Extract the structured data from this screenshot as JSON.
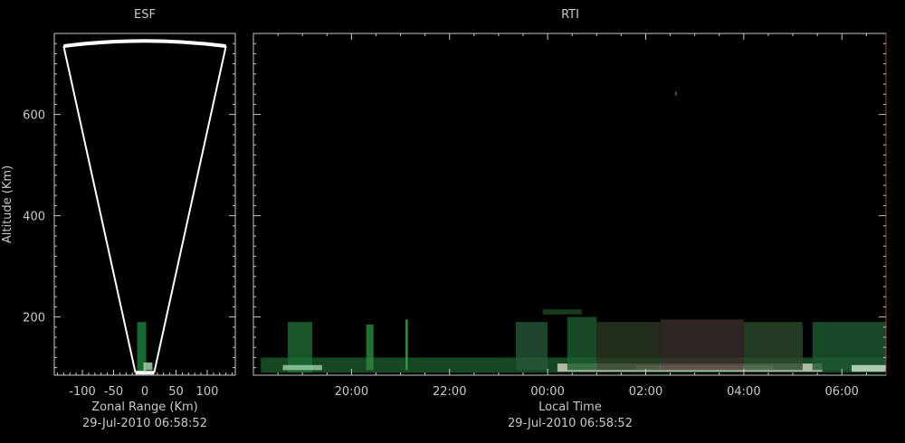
{
  "chart_data": [
    {
      "type": "heatmap",
      "title": "ESF",
      "xlabel": "Zonal Range (Km)",
      "ylabel": "Altitude (Km)",
      "timestamp": "29-Jul-2010 06:58:52",
      "x_ticks": [
        -100,
        -50,
        0,
        50,
        100
      ],
      "x_tick_labels": [
        "-100",
        "-50",
        "0",
        "50",
        "100"
      ],
      "xlim": [
        -145,
        145
      ],
      "y_ticks": [
        200,
        400,
        600
      ],
      "y_tick_labels": [
        "200",
        "400",
        "600"
      ],
      "ylim": [
        85,
        760
      ],
      "fan": {
        "inner_radius_km": 90,
        "outer_radius_km": 745,
        "top_half_width_km": 130,
        "bottom_half_width_km": 15
      },
      "echoes": [
        {
          "x": -5,
          "y0": 90,
          "y1": 190,
          "color": "#1c7a3c"
        },
        {
          "x": 5,
          "y0": 95,
          "y1": 110,
          "color": "#9fd0a8"
        }
      ]
    },
    {
      "type": "heatmap",
      "title": "RTI",
      "xlabel": "Local Time",
      "timestamp": "29-Jul-2010 06:58:52",
      "x_ticks": [
        20,
        22,
        24,
        26,
        28,
        30
      ],
      "x_tick_labels": [
        "20:00",
        "22:00",
        "00:00",
        "02:00",
        "04:00",
        "06:00"
      ],
      "xlim": [
        18.0,
        30.9
      ],
      "y_ticks": [
        200,
        400,
        600
      ],
      "ylim": [
        85,
        760
      ],
      "bands": [
        {
          "t0": 18.15,
          "t1": 30.9,
          "y0": 90,
          "y1": 120,
          "color": "#1a5a2a"
        },
        {
          "t0": 24.2,
          "t1": 29.6,
          "y0": 92,
          "y1": 108,
          "color": "#d8d8c8"
        },
        {
          "t0": 25.8,
          "t1": 28.6,
          "y0": 96,
          "y1": 104,
          "color": "#ffffff"
        },
        {
          "t0": 18.7,
          "t1": 19.2,
          "y0": 90,
          "y1": 190,
          "color": "#1e6b35"
        },
        {
          "t0": 20.3,
          "t1": 20.45,
          "y0": 95,
          "y1": 185,
          "color": "#2e8a3e"
        },
        {
          "t0": 21.1,
          "t1": 21.15,
          "y0": 95,
          "y1": 195,
          "color": "#3aa84a"
        },
        {
          "t0": 23.35,
          "t1": 24.0,
          "y0": 95,
          "y1": 190,
          "color": "#24563a"
        },
        {
          "t0": 24.4,
          "t1": 25.0,
          "y0": 95,
          "y1": 200,
          "color": "#1d5e2f"
        },
        {
          "t0": 25.0,
          "t1": 26.3,
          "y0": 95,
          "y1": 190,
          "color": "#2a3a22"
        },
        {
          "t0": 26.3,
          "t1": 28.0,
          "y0": 95,
          "y1": 195,
          "color": "#3b2e2a"
        },
        {
          "t0": 28.0,
          "t1": 29.2,
          "y0": 95,
          "y1": 190,
          "color": "#2a4a2a"
        },
        {
          "t0": 29.4,
          "t1": 30.9,
          "y0": 95,
          "y1": 190,
          "color": "#1f5a32"
        },
        {
          "t0": 23.9,
          "t1": 24.7,
          "y0": 205,
          "y1": 215,
          "color": "#1a4a22"
        },
        {
          "t0": 30.2,
          "t1": 30.9,
          "y0": 92,
          "y1": 105,
          "color": "#cfe8d6"
        },
        {
          "t0": 18.6,
          "t1": 19.4,
          "y0": 95,
          "y1": 105,
          "color": "#9fd0a8"
        },
        {
          "t0": 26.6,
          "t1": 26.63,
          "y0": 638,
          "y1": 645,
          "color": "#c06030"
        }
      ]
    }
  ]
}
